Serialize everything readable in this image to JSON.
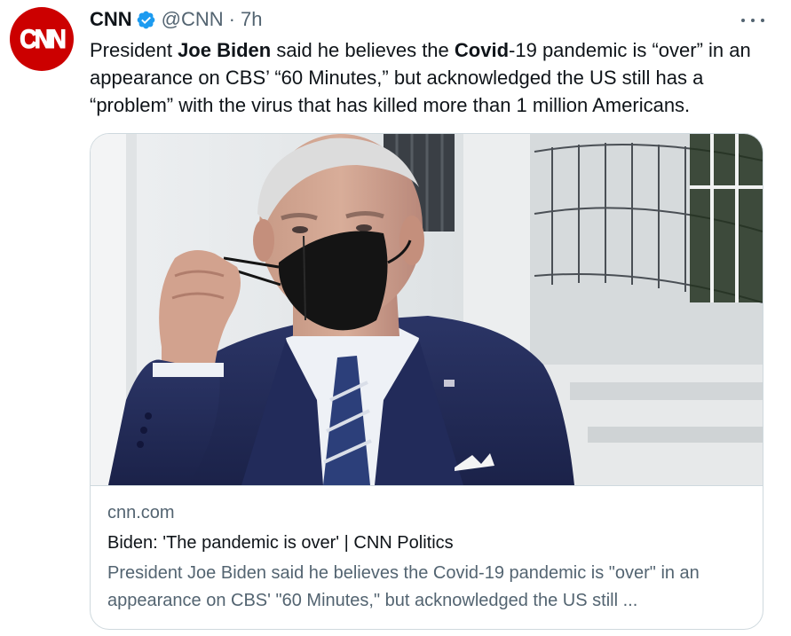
{
  "tweet": {
    "author_name": "CNN",
    "handle": "@CNN",
    "separator": "·",
    "time": "7h",
    "avatar_text": "CNN",
    "text_parts": [
      {
        "t": "President ",
        "b": false
      },
      {
        "t": "Joe Biden",
        "b": true
      },
      {
        "t": " said he believes the ",
        "b": false
      },
      {
        "t": "Covid",
        "b": true
      },
      {
        "t": "-19 pandemic is “over” in an appearance on CBS’ “60 Minutes,” but acknowledged the US still has a “problem” with the virus that has killed more than 1 million Americans.",
        "b": false
      }
    ]
  },
  "card": {
    "domain": "cnn.com",
    "title": "Biden: 'The pandemic is over' | CNN Politics",
    "description": "President Joe Biden said he believes the Covid-19 pandemic is \"over\" in an appearance on CBS' \"60 Minutes,\" but acknowledged the US still ..."
  },
  "colors": {
    "brand_red": "#cc0000",
    "verified_blue": "#1d9bf0",
    "secondary_text": "#536471",
    "border": "#cfd9de"
  },
  "icons": {
    "verified": "verified-badge-icon",
    "more": "more-options-icon"
  }
}
